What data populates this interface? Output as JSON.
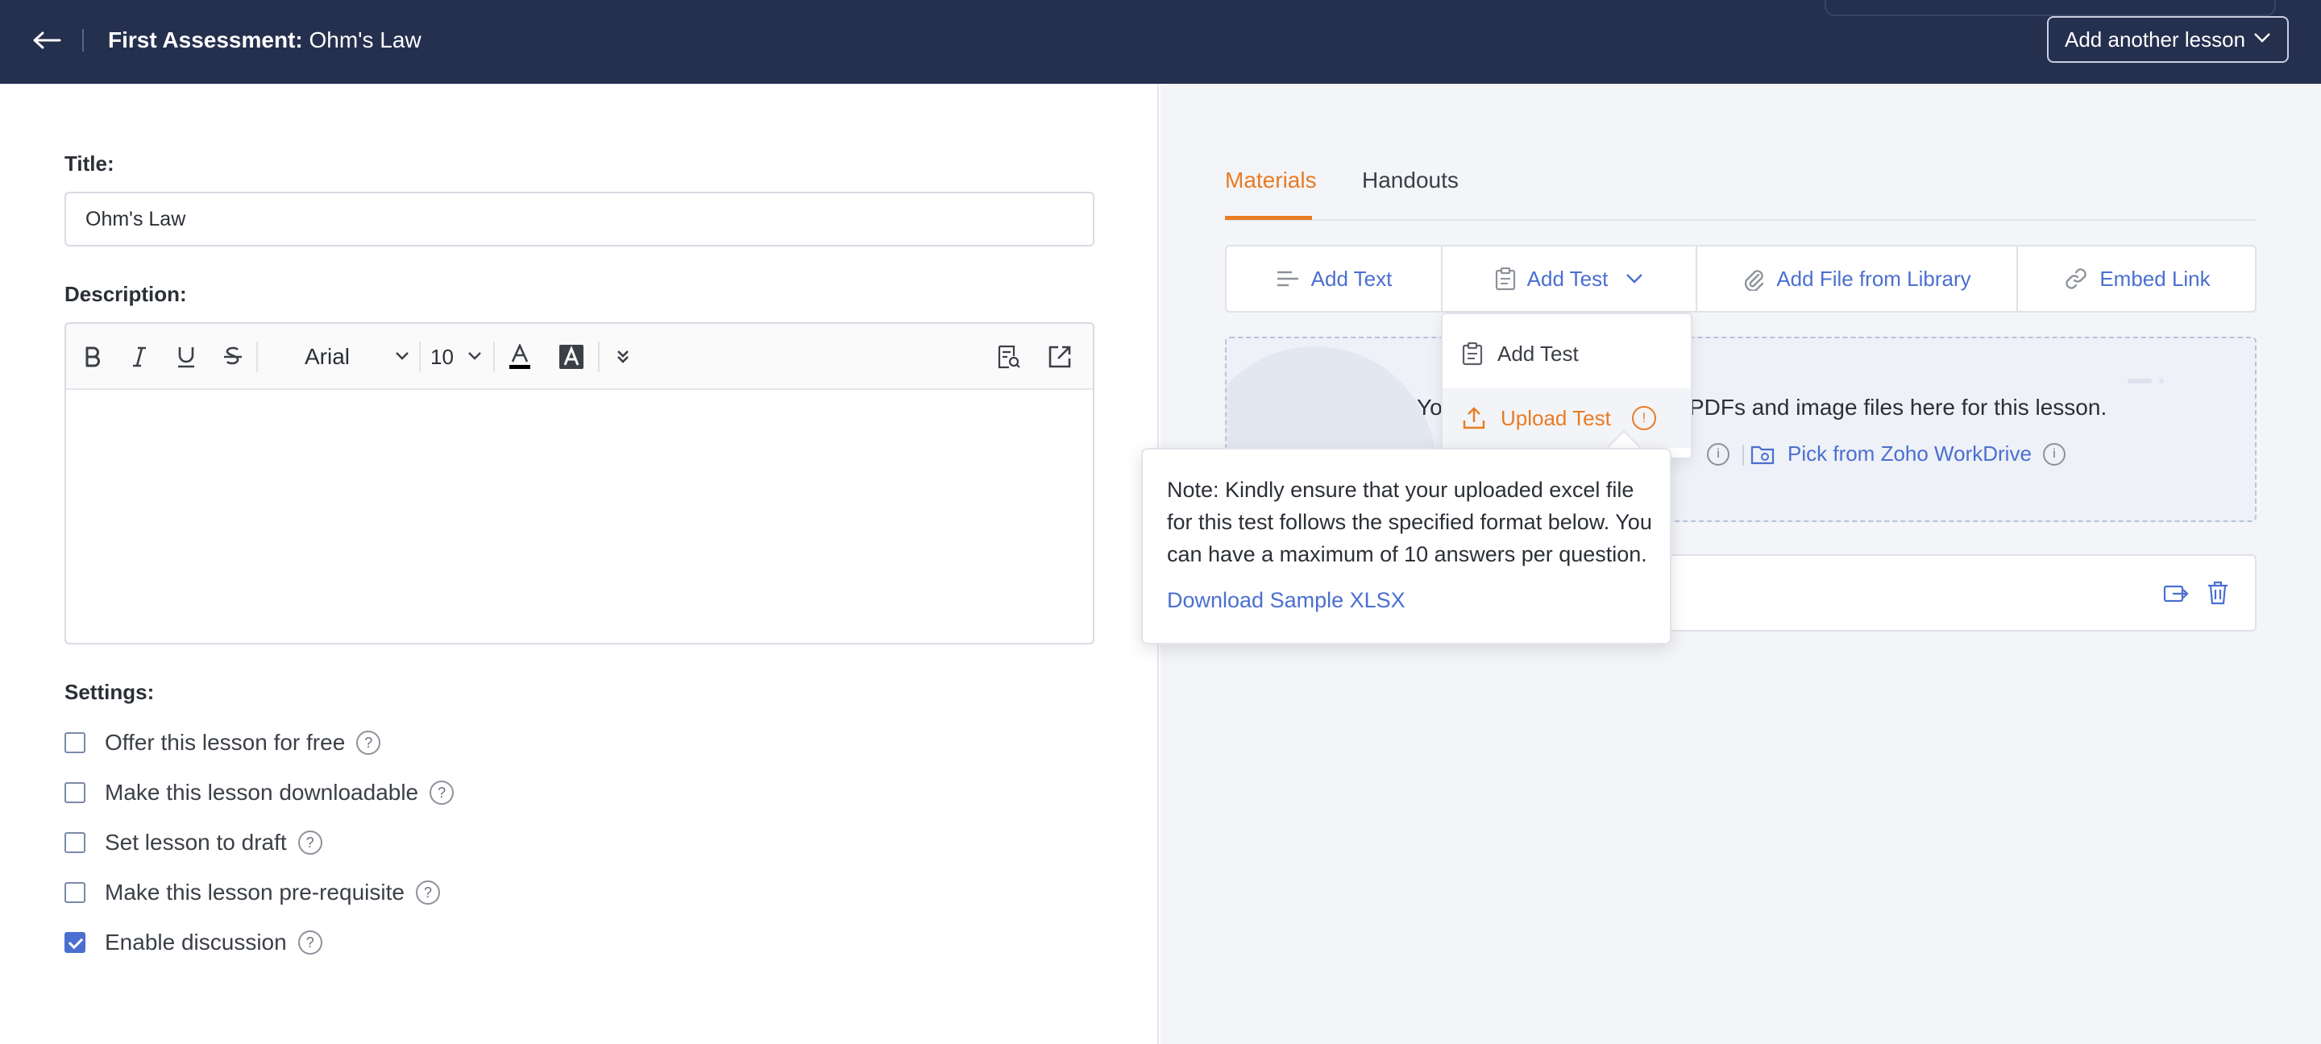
{
  "header": {
    "title_prefix": "First Assessment:",
    "title_name": "Ohm's Law",
    "add_lesson_label": "Add another lesson"
  },
  "form": {
    "title_label": "Title:",
    "title_value": "Ohm's Law",
    "description_label": "Description:",
    "editor": {
      "font": "Arial",
      "size": "10"
    },
    "settings_label": "Settings:",
    "settings": [
      {
        "label": "Offer this lesson for free",
        "checked": false
      },
      {
        "label": "Make this lesson downloadable",
        "checked": false
      },
      {
        "label": "Set lesson to draft",
        "checked": false
      },
      {
        "label": "Make this lesson pre-requisite",
        "checked": false
      },
      {
        "label": "Enable discussion",
        "checked": true
      }
    ]
  },
  "materials": {
    "tabs": [
      "Materials",
      "Handouts"
    ],
    "actions": {
      "add_text": "Add Text",
      "add_test": "Add Test",
      "add_file": "Add File from Library",
      "embed_link": "Embed Link"
    },
    "dropzone": {
      "text_start": "Yo",
      "text_end": "PDFs and image files here for this lesson.",
      "workdrive_link": "Pick from Zoho WorkDrive"
    }
  },
  "dropdown": {
    "items": [
      "Add Test",
      "Upload Test"
    ]
  },
  "tooltip": {
    "note": "Note: Kindly ensure that your uploaded excel file for this test follows the specified format below. You can have a maximum of 10 answers per question.",
    "link": "Download Sample XLSX"
  },
  "colors": {
    "header_bg": "#252f4e",
    "accent_orange": "#e87b24",
    "link_blue": "#4a6fd0"
  }
}
